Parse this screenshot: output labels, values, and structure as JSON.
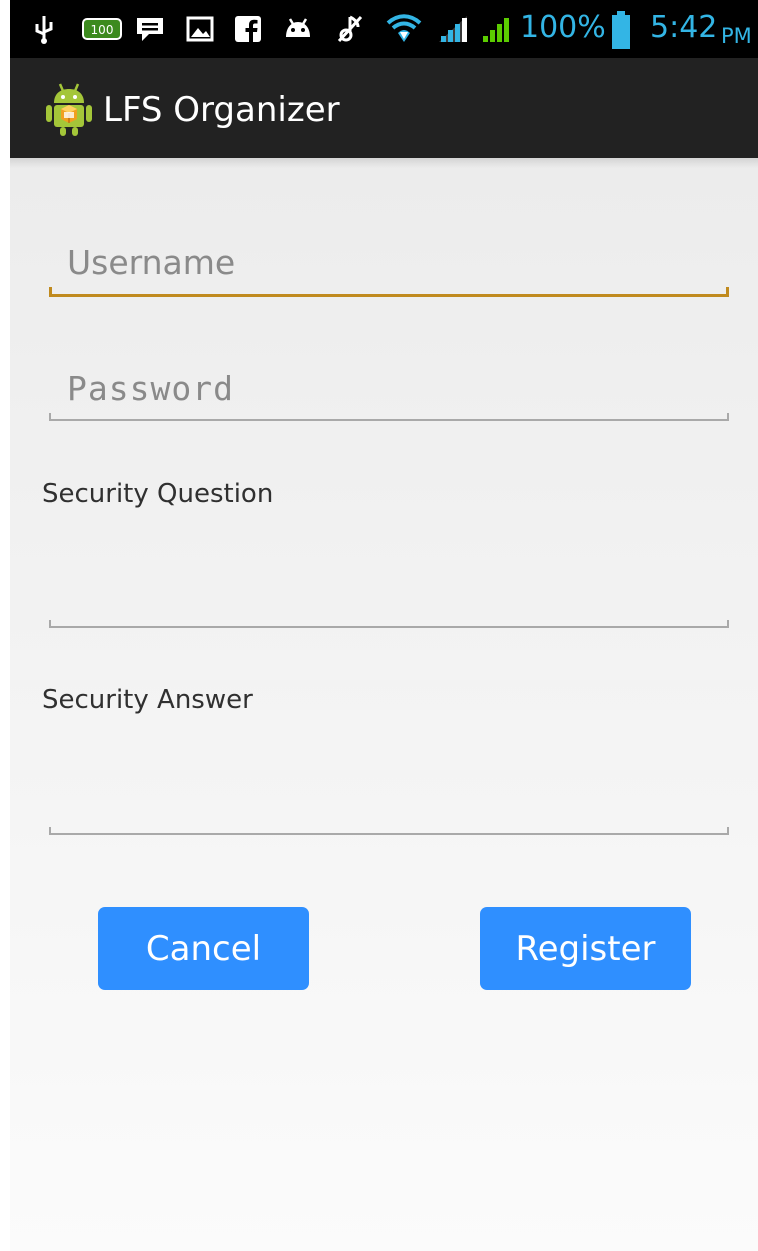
{
  "status_bar": {
    "icons": [
      "usb-icon",
      "battery-100-notification-icon",
      "chat-icon",
      "gallery-icon",
      "facebook-icon",
      "android-notification-icon",
      "mute-icon",
      "wifi-icon",
      "signal-icon",
      "signal-icon"
    ],
    "battery_percent": "100%",
    "time": "5:42",
    "ampm": "PM",
    "mini_battery_label": "100"
  },
  "action_bar": {
    "title": "LFS Organizer",
    "icon": "android-app-icon"
  },
  "form": {
    "username_placeholder": "Username",
    "password_placeholder": "Password",
    "security_question_label": "Security Question",
    "security_answer_label": "Security Answer",
    "security_question_value": "",
    "security_answer_value": ""
  },
  "buttons": {
    "cancel": "Cancel",
    "register": "Register"
  },
  "colors": {
    "accent_focus": "#c08a1e",
    "button": "#2f8fff",
    "status_text": "#33b5e5",
    "signal_green": "#5ccc00"
  }
}
